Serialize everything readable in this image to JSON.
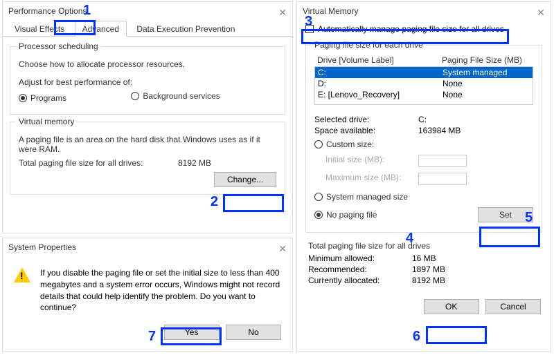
{
  "perf": {
    "title": "Performance Options",
    "tabs": {
      "visual": "Visual Effects",
      "advanced": "Advanced",
      "dep": "Data Execution Prevention"
    },
    "proc": {
      "legend": "Processor scheduling",
      "desc": "Choose how to allocate processor resources.",
      "adjust": "Adjust for best performance of:",
      "programs": "Programs",
      "bg": "Background services"
    },
    "vm": {
      "legend": "Virtual memory",
      "desc": "A paging file is an area on the hard disk that Windows uses as if it were RAM.",
      "total_label": "Total paging file size for all drives:",
      "total_value": "8192 MB",
      "change": "Change..."
    }
  },
  "sysprop": {
    "title": "System Properties",
    "msg": "If you disable the paging file or set the initial size to less than 400 megabytes and a system error occurs, Windows might not record details that could help identify the problem. Do you want to continue?",
    "yes": "Yes",
    "no": "No"
  },
  "vmem": {
    "title": "Virtual Memory",
    "auto": "Automatically manage paging file size for all drives",
    "each_legend": "Paging file size for each drive",
    "head_drive": "Drive  [Volume Label]",
    "head_size": "Paging File Size (MB)",
    "drives": [
      {
        "label": "C:",
        "size": "System managed",
        "sel": true
      },
      {
        "label": "D:",
        "size": "None",
        "sel": false
      },
      {
        "label": "E:        [Lenovo_Recovery]",
        "size": "None",
        "sel": false
      }
    ],
    "selected_drive_label": "Selected drive:",
    "selected_drive": "C:",
    "space_label": "Space available:",
    "space": "163984 MB",
    "custom": "Custom size:",
    "init_label": "Initial size (MB):",
    "max_label": "Maximum size (MB):",
    "sysmanaged": "System managed size",
    "nopaging": "No paging file",
    "set": "Set",
    "total_legend": "Total paging file size for all drives",
    "min_label": "Minimum allowed:",
    "min": "16 MB",
    "rec_label": "Recommended:",
    "rec": "1897 MB",
    "cur_label": "Currently allocated:",
    "cur": "8192 MB",
    "ok": "OK",
    "cancel": "Cancel"
  },
  "annotations": {
    "n1": "1",
    "n2": "2",
    "n3": "3",
    "n4": "4",
    "n5": "5",
    "n6": "6",
    "n7": "7"
  }
}
